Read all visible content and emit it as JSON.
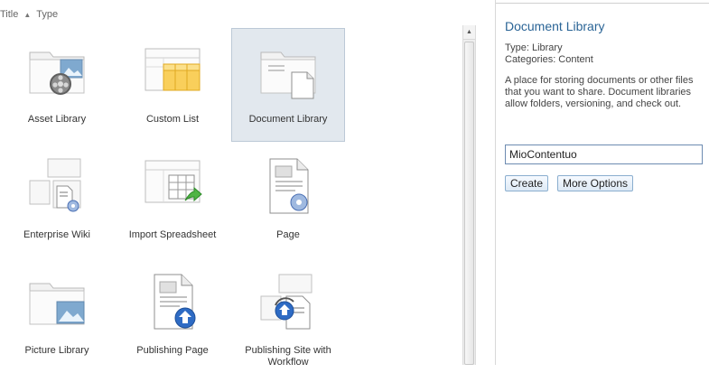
{
  "sort": {
    "title": "Title",
    "type": "Type"
  },
  "tiles": [
    {
      "label": "Asset Library",
      "icon": "asset-library-icon",
      "selected": false
    },
    {
      "label": "Custom List",
      "icon": "custom-list-icon",
      "selected": false
    },
    {
      "label": "Document Library",
      "icon": "document-library-icon",
      "selected": true
    },
    {
      "label": "Enterprise Wiki",
      "icon": "enterprise-wiki-icon",
      "selected": false
    },
    {
      "label": "Import Spreadsheet",
      "icon": "import-spreadsheet-icon",
      "selected": false
    },
    {
      "label": "Page",
      "icon": "page-icon",
      "selected": false
    },
    {
      "label": "Picture Library",
      "icon": "picture-library-icon",
      "selected": false
    },
    {
      "label": "Publishing Page",
      "icon": "publishing-page-icon",
      "selected": false
    },
    {
      "label": "Publishing Site with Workflow",
      "icon": "publishing-site-workflow-icon",
      "selected": false
    }
  ],
  "panel": {
    "title": "Document Library",
    "type_line": "Type: Library",
    "categories_line": "Categories: Content",
    "description": "A place for storing documents or other files that you want to share. Document libraries allow folders, versioning, and check out.",
    "name_value": "MioContentuo",
    "create_label": "Create",
    "more_options_label": "More Options"
  },
  "colors": {
    "accent": "#2a6496",
    "selected_bg": "#e2e8ee",
    "button_border": "#8aaecf"
  }
}
